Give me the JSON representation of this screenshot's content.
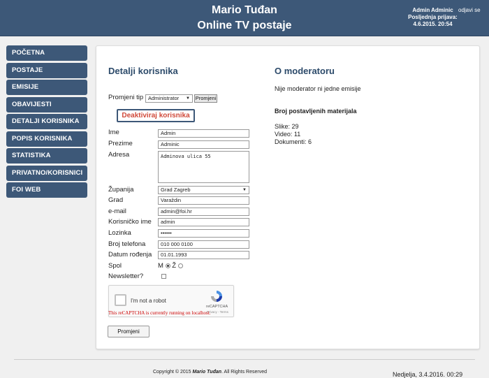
{
  "header": {
    "title_line1": "Mario Tuđan",
    "title_line2": "Online TV postaje",
    "user_name": "Admin Adminic",
    "last_login_label": "Posljednja prijava:",
    "last_login_value": "4.6.2015. 20:54",
    "logout_label": "odjavi se"
  },
  "sidebar": {
    "items": [
      {
        "label": "POČETNA"
      },
      {
        "label": "POSTAJE"
      },
      {
        "label": "EMISIJE"
      },
      {
        "label": "OBAVIJESTI"
      },
      {
        "label": "DETALJI KORISNIKA"
      },
      {
        "label": "POPIS KORISNIKA"
      },
      {
        "label": "STATISTIKA"
      },
      {
        "label": "PRIVATNO/KORISNICI"
      },
      {
        "label": "FOI WEB"
      }
    ]
  },
  "user_details": {
    "title": "Detalji korisnika",
    "change_type_label": "Promjeni tip",
    "type_value": "Administrator",
    "change_type_button": "Promjeni",
    "deactivate_button": "Deaktiviraj korisnika",
    "labels": {
      "first_name": "Ime",
      "last_name": "Prezime",
      "address": "Adresa",
      "county": "Županija",
      "city": "Grad",
      "email": "e-mail",
      "username": "Korisničko ime",
      "password": "Lozinka",
      "phone": "Broj telefona",
      "birth_date": "Datum rođenja",
      "gender": "Spol",
      "newsletter": "Newsletter?"
    },
    "values": {
      "first_name": "Admin",
      "last_name": "Adminic",
      "address": "Adminova ulica 55",
      "county": "Grad Zagreb",
      "city": "Varaždin",
      "email": "admin@foi.hr",
      "username": "admin",
      "password": "••••••",
      "phone": "010 000 0100",
      "birth_date": "01.01.1993"
    },
    "gender_male": "M",
    "gender_female": "Ž",
    "gender_selected": "M",
    "newsletter_checked": false,
    "captcha": {
      "label": "I'm not a robot",
      "brand": "reCAPTCHA",
      "privacy": "Privacy - Terms",
      "warning": "This reCAPTCHA is currently running on localhost."
    },
    "submit_button": "Promjeni"
  },
  "moderator": {
    "title": "O moderatoru",
    "none_text": "Nije moderator ni jedne emisije",
    "materials_title": "Broj postavljenih materijala",
    "images": "Slike: 29",
    "video": "Video: 11",
    "documents": "Dokumenti: 6"
  },
  "footer": {
    "copyright_prefix": "Copyright © 2015 ",
    "copyright_name": "Mario Tuđan",
    "copyright_suffix": ". All Rights Reserved",
    "datetime": "Nedjelja, 3.4.2016. 00:29"
  },
  "colors": {
    "header_bg": "#3d5878",
    "title_color": "#2c4a6a",
    "deactivate_text": "#d04a3a"
  }
}
